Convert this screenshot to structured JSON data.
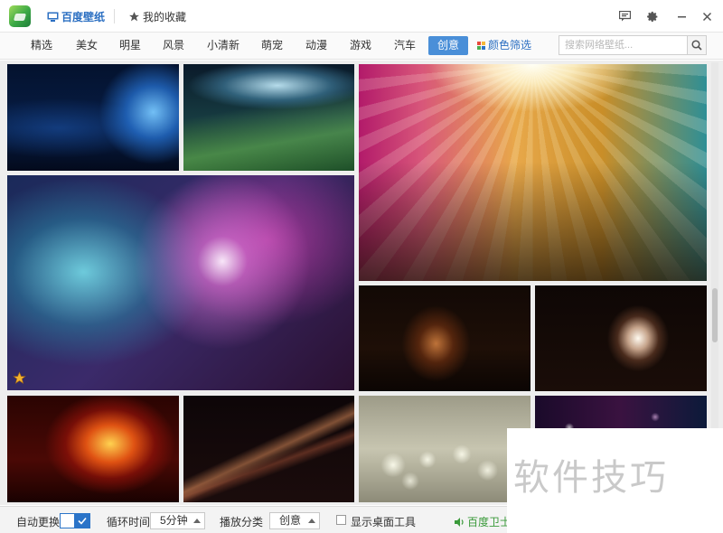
{
  "topbar": {
    "tabs": [
      {
        "label": "百度壁纸",
        "icon": "monitor-icon",
        "active": true
      },
      {
        "label": "我的收藏",
        "icon": "star-icon",
        "active": false
      }
    ],
    "controls": [
      "feedback-icon",
      "gear-icon",
      "minimize-icon",
      "close-icon"
    ]
  },
  "categories": {
    "items": [
      "精选",
      "美女",
      "明星",
      "风景",
      "小清新",
      "萌宠",
      "动漫",
      "游戏",
      "汽车",
      "创意"
    ],
    "active": "创意",
    "color_filter_label": "颜色筛选",
    "color_filter_colors": [
      "#e84a3c",
      "#f5b83a",
      "#4caf50",
      "#2b74c8"
    ]
  },
  "search": {
    "placeholder": "搜索网络壁纸...",
    "value": ""
  },
  "wallpapers": [
    {
      "theme": "blue-swirl",
      "favorited": false
    },
    {
      "theme": "green-light-rays",
      "favorited": false
    },
    {
      "theme": "golden-rays",
      "favorited": false
    },
    {
      "theme": "star-burst",
      "favorited": true
    },
    {
      "theme": "orange-swirl-dark",
      "favorited": false
    },
    {
      "theme": "glowing-smoke",
      "favorited": false
    },
    {
      "theme": "fire-swirl",
      "favorited": false
    },
    {
      "theme": "light-streaks",
      "favorited": false
    },
    {
      "theme": "bokeh-lights",
      "favorited": false
    },
    {
      "theme": "sparkle-night",
      "favorited": false
    }
  ],
  "bottombar": {
    "auto_change_label": "自动更换",
    "auto_change_enabled": true,
    "interval_label": "循环时间",
    "interval_value": "5分钟",
    "category_label": "播放分类",
    "category_value": "创意",
    "show_desktop_tool_label": "显示桌面工具",
    "show_desktop_tool_checked": false,
    "guard_label": "百度卫士"
  },
  "watermark": "软件技巧"
}
